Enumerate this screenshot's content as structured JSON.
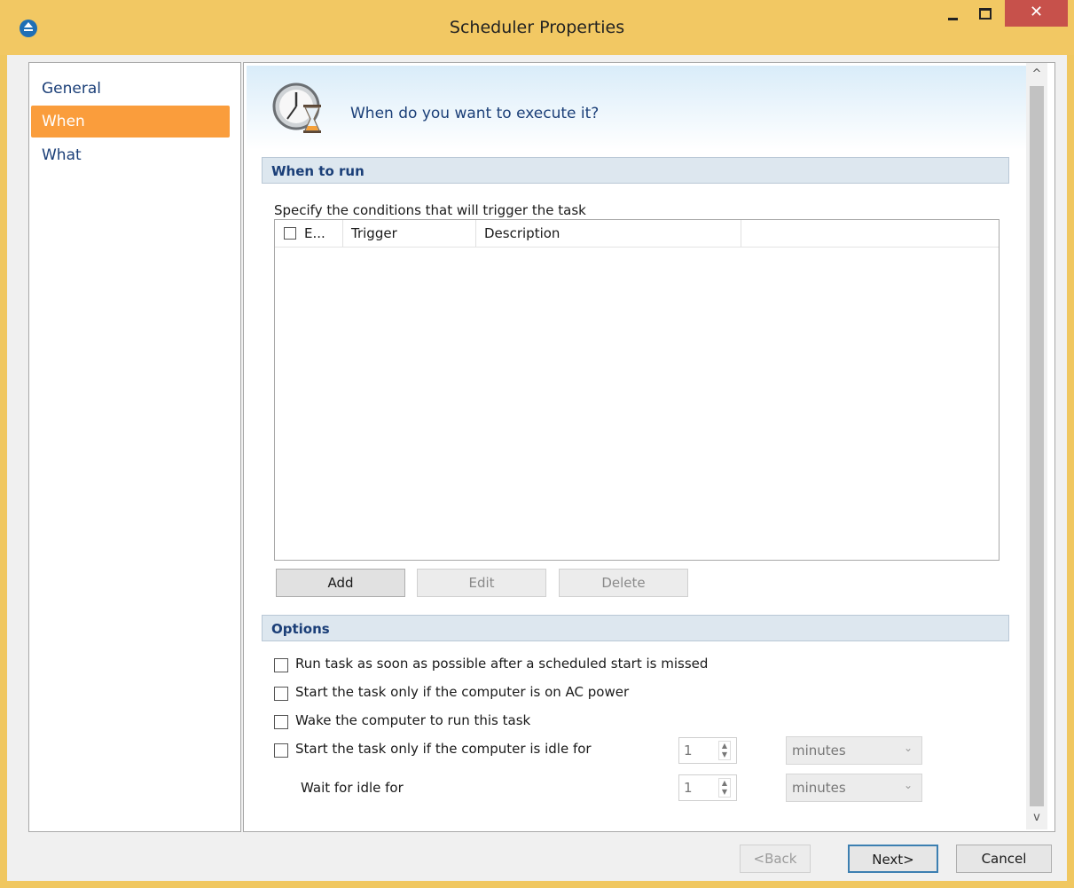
{
  "window": {
    "title": "Scheduler Properties",
    "close_glyph": "✕"
  },
  "nav": {
    "items": [
      {
        "label": "General"
      },
      {
        "label": "When"
      },
      {
        "label": "What"
      }
    ],
    "selected": "When"
  },
  "header": {
    "text": "When do you want to execute it?",
    "icon": "clock-hourglass-icon"
  },
  "when_to_run": {
    "title": "When to run",
    "description": "Specify the conditions that will trigger the task",
    "columns": [
      "E...",
      "Trigger",
      "Description"
    ],
    "rows": [],
    "buttons": {
      "add": "Add",
      "edit": "Edit",
      "delete": "Delete"
    }
  },
  "options": {
    "title": "Options",
    "run_missed": "Run task as soon as possible after a scheduled start is missed",
    "ac_power": "Start the task only if the computer is on AC power",
    "wake": "Wake the computer to run this task",
    "idle": "Start the task only if the computer is idle for",
    "idle_value": "1",
    "idle_unit": "minutes",
    "wait_label": "Wait for idle for",
    "wait_value": "1",
    "wait_unit": "minutes"
  },
  "footer": {
    "back": "<Back",
    "next": "Next>",
    "cancel": "Cancel"
  },
  "colors": {
    "titlebar": "#f2c863",
    "accent": "#fa9d3c",
    "close": "#c7514b",
    "link_text": "#1b3f78"
  }
}
